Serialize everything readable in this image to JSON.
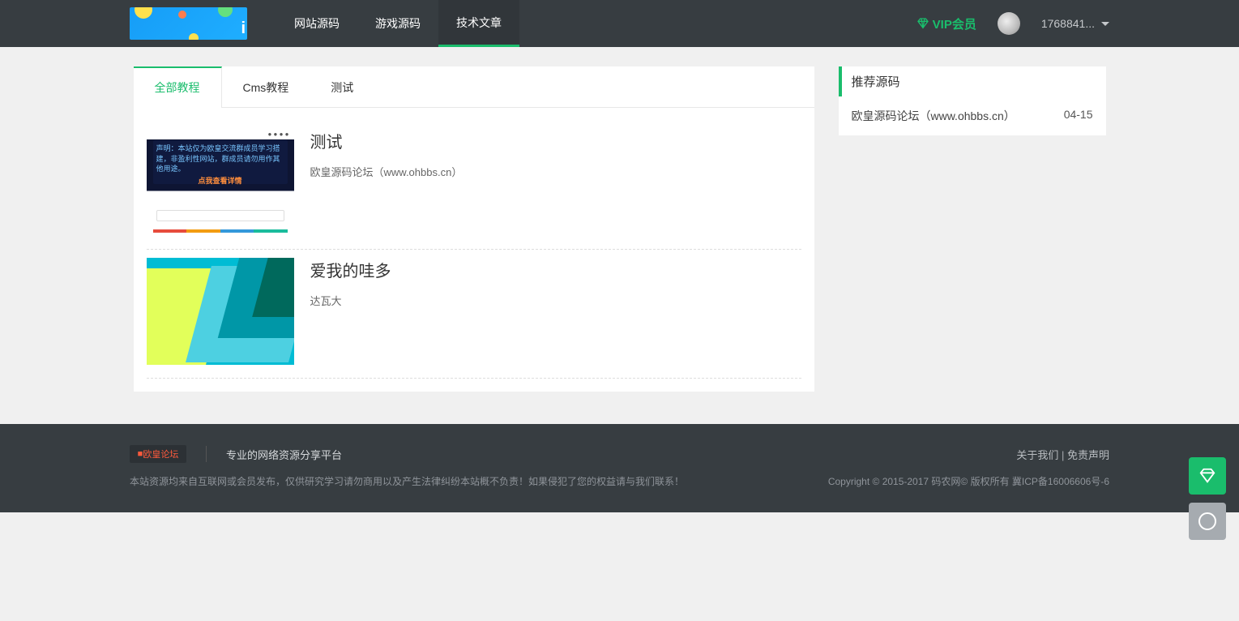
{
  "header": {
    "logo_fragment": "i",
    "nav": [
      {
        "label": "网站源码",
        "active": false
      },
      {
        "label": "游戏源码",
        "active": false
      },
      {
        "label": "技术文章",
        "active": true
      }
    ],
    "vip_label": "VIP会员",
    "username": "1768841..."
  },
  "tabs": [
    {
      "label": "全部教程",
      "active": true
    },
    {
      "label": "Cms教程",
      "active": false
    },
    {
      "label": "测试",
      "active": false
    }
  ],
  "articles": [
    {
      "title": "测试",
      "desc": "欧皇源码论坛（www.ohbbs.cn）",
      "thumb_lines": "声明：本站仅为欧皇交流群成员学习搭建，非盈利性网站，群成员请勿用作其他用途。",
      "thumb_btn": "点我查看详情"
    },
    {
      "title": "爱我的哇多",
      "desc": "达瓦大"
    }
  ],
  "sidebar": {
    "title": "推荐源码",
    "items": [
      {
        "label": "欧皇源码论坛（www.ohbbs.cn）",
        "date": "04-15"
      }
    ]
  },
  "footer": {
    "logo_text": "欧皇论坛",
    "slogan": "专业的网络资源分享平台",
    "links": {
      "about": "关于我们",
      "disclaimer": "免责声明",
      "sep": " | "
    },
    "statement": "本站资源均来自互联网或会员发布，仅供研究学习请勿商用以及产生法律纠纷本站概不负责！如果侵犯了您的权益请与我们联系！",
    "copyright": "Copyright © 2015-2017 码农网© 版权所有 冀ICP备16006606号-6"
  },
  "colors": {
    "accent": "#1abd6c",
    "header": "#373d41"
  }
}
